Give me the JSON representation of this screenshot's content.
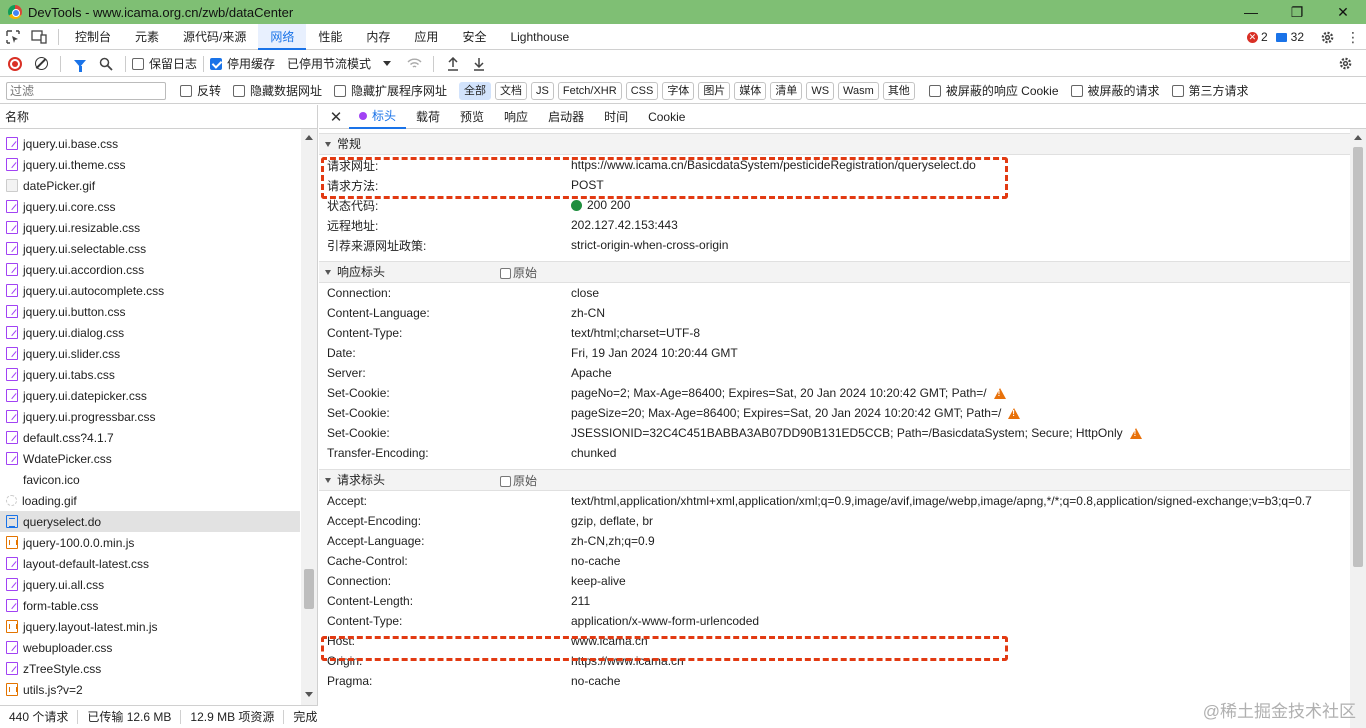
{
  "window": {
    "title": "DevTools - www.icama.org.cn/zwb/dataCenter",
    "controls": [
      "—",
      "❐",
      "✕"
    ]
  },
  "main_tabs": [
    "控制台",
    "元素",
    "源代码/来源",
    "网络",
    "性能",
    "内存",
    "应用",
    "安全",
    "Lighthouse"
  ],
  "active_main_tab": "网络",
  "badges": {
    "errors": "2",
    "messages": "32"
  },
  "network_toolbar": {
    "preserve_log": "保留日志",
    "disable_cache": "停用缓存",
    "throttle": "已停用节流模式"
  },
  "filter_bar": {
    "placeholder": "过滤",
    "invert": "反转",
    "hide_data_urls": "隐藏数据网址",
    "hide_ext_urls": "隐藏扩展程序网址",
    "chips": [
      "全部",
      "文档",
      "JS",
      "Fetch/XHR",
      "CSS",
      "字体",
      "图片",
      "媒体",
      "清单",
      "WS",
      "Wasm",
      "其他"
    ],
    "active_chip": "全部",
    "blocked_cookies": "被屏蔽的响应 Cookie",
    "blocked_requests": "被屏蔽的请求",
    "third_party": "第三方请求"
  },
  "left_panel": {
    "header": "名称",
    "files": [
      {
        "name": "jquery.ui.base.css",
        "type": "css"
      },
      {
        "name": "jquery.ui.theme.css",
        "type": "css"
      },
      {
        "name": "datePicker.gif",
        "type": "img"
      },
      {
        "name": "jquery.ui.core.css",
        "type": "css"
      },
      {
        "name": "jquery.ui.resizable.css",
        "type": "css"
      },
      {
        "name": "jquery.ui.selectable.css",
        "type": "css"
      },
      {
        "name": "jquery.ui.accordion.css",
        "type": "css"
      },
      {
        "name": "jquery.ui.autocomplete.css",
        "type": "css"
      },
      {
        "name": "jquery.ui.button.css",
        "type": "css"
      },
      {
        "name": "jquery.ui.dialog.css",
        "type": "css"
      },
      {
        "name": "jquery.ui.slider.css",
        "type": "css"
      },
      {
        "name": "jquery.ui.tabs.css",
        "type": "css"
      },
      {
        "name": "jquery.ui.datepicker.css",
        "type": "css"
      },
      {
        "name": "jquery.ui.progressbar.css",
        "type": "css"
      },
      {
        "name": "default.css?4.1.7",
        "type": "css"
      },
      {
        "name": "WdatePicker.css",
        "type": "css"
      },
      {
        "name": "favicon.ico",
        "type": "none"
      },
      {
        "name": "loading.gif",
        "type": "loading"
      },
      {
        "name": "queryselect.do",
        "type": "doc",
        "selected": true
      },
      {
        "name": "jquery-100.0.0.min.js",
        "type": "js"
      },
      {
        "name": "layout-default-latest.css",
        "type": "css"
      },
      {
        "name": "jquery.ui.all.css",
        "type": "css"
      },
      {
        "name": "form-table.css",
        "type": "css"
      },
      {
        "name": "jquery.layout-latest.min.js",
        "type": "js"
      },
      {
        "name": "webuploader.css",
        "type": "css"
      },
      {
        "name": "zTreeStyle.css",
        "type": "css"
      },
      {
        "name": "utils.js?v=2",
        "type": "js"
      }
    ]
  },
  "status_bar": [
    "440 个请求",
    "已传输 12.6 MB",
    "12.9 MB 项资源",
    "完成"
  ],
  "detail_tabs": [
    "标头",
    "载荷",
    "预览",
    "响应",
    "启动器",
    "时间",
    "Cookie"
  ],
  "active_detail_tab": "标头",
  "general": {
    "title": "常规",
    "rows": [
      {
        "k": "请求网址:",
        "v": "https://www.icama.cn/BasicdataSystem/pesticideRegistration/queryselect.do"
      },
      {
        "k": "请求方法:",
        "v": "POST"
      },
      {
        "k": "状态代码:",
        "v": "200 200",
        "status": true
      },
      {
        "k": "远程地址:",
        "v": "202.127.42.153:443"
      },
      {
        "k": "引荐来源网址政策:",
        "v": "strict-origin-when-cross-origin"
      }
    ]
  },
  "response_headers": {
    "title": "响应标头",
    "raw_label": "原始",
    "rows": [
      {
        "k": "Connection:",
        "v": "close"
      },
      {
        "k": "Content-Language:",
        "v": "zh-CN"
      },
      {
        "k": "Content-Type:",
        "v": "text/html;charset=UTF-8"
      },
      {
        "k": "Date:",
        "v": "Fri, 19 Jan 2024 10:20:44 GMT"
      },
      {
        "k": "Server:",
        "v": "Apache"
      },
      {
        "k": "Set-Cookie:",
        "v": "pageNo=2; Max-Age=86400; Expires=Sat, 20 Jan 2024 10:20:42 GMT; Path=/",
        "warn": true
      },
      {
        "k": "Set-Cookie:",
        "v": "pageSize=20; Max-Age=86400; Expires=Sat, 20 Jan 2024 10:20:42 GMT; Path=/",
        "warn": true
      },
      {
        "k": "Set-Cookie:",
        "v": "JSESSIONID=32C4C451BABBA3AB07DD90B131ED5CCB; Path=/BasicdataSystem; Secure; HttpOnly",
        "warn": true
      },
      {
        "k": "Transfer-Encoding:",
        "v": "chunked"
      }
    ]
  },
  "request_headers": {
    "title": "请求标头",
    "raw_label": "原始",
    "rows": [
      {
        "k": "Accept:",
        "v": "text/html,application/xhtml+xml,application/xml;q=0.9,image/avif,image/webp,image/apng,*/*;q=0.8,application/signed-exchange;v=b3;q=0.7"
      },
      {
        "k": "Accept-Encoding:",
        "v": "gzip, deflate, br"
      },
      {
        "k": "Accept-Language:",
        "v": "zh-CN,zh;q=0.9"
      },
      {
        "k": "Cache-Control:",
        "v": "no-cache"
      },
      {
        "k": "Connection:",
        "v": "keep-alive"
      },
      {
        "k": "Content-Length:",
        "v": "211"
      },
      {
        "k": "Content-Type:",
        "v": "application/x-www-form-urlencoded"
      },
      {
        "k": "Host:",
        "v": "www.icama.cn"
      },
      {
        "k": "Origin:",
        "v": "https://www.icama.cn"
      },
      {
        "k": "Pragma:",
        "v": "no-cache"
      }
    ]
  },
  "watermark": "@稀土掘金技术社区",
  "colors": {
    "accent": "#1a73e8",
    "highlight": "#e23a12",
    "titlebar": "#7fbf74"
  }
}
